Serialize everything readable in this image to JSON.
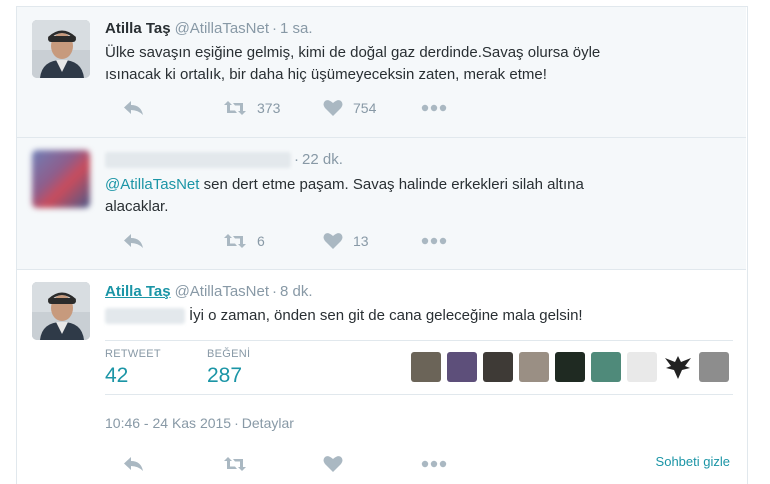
{
  "colors": {
    "accent": "#1b95a6",
    "muted": "#8899a6",
    "icon": "#aab8c2",
    "background": "#f5f8fa"
  },
  "tweets": [
    {
      "name": "Atilla Taş",
      "handle": "@AtillaTasNet",
      "time": "1 sa.",
      "text": "Ülke savaşın eşiğine gelmiş, kimi de doğal gaz derdinde.Savaş olursa öyle\nısınacak ki ortalık, bir daha hiç üşümeyeceksin zaten, merak etme!",
      "retweets": "373",
      "likes": "754"
    },
    {
      "time": "22 dk.",
      "mention": "@AtillaTasNet",
      "text": " sen dert etme paşam. Savaş halinde erkekleri silah altına\nalacaklar.",
      "retweets": "6",
      "likes": "13"
    },
    {
      "name": "Atilla Taş",
      "handle": "@AtillaTasNet",
      "time": "8 dk.",
      "text": "İyi o zaman, önden sen git de cana geleceğine mala gelsin!",
      "retweet_label": "RETWEET",
      "retweet_count": "42",
      "like_label": "BEĞENİ",
      "like_count": "287",
      "timestamp": "10:46 - 24 Kas 2015",
      "details": "Detaylar",
      "hide_conversation": "Sohbeti gizle"
    }
  ],
  "icons": [
    "reply-icon",
    "retweet-icon",
    "heart-icon",
    "more-icon"
  ]
}
